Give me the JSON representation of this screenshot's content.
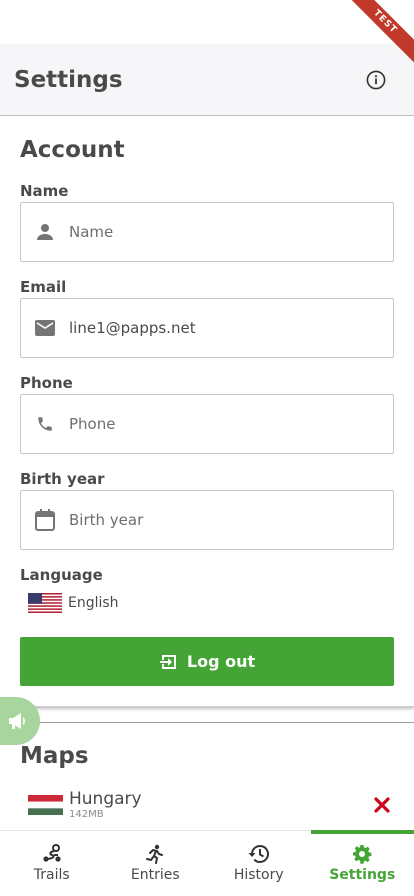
{
  "header": {
    "title": "Settings",
    "info_icon": "info-circle-icon"
  },
  "ribbon": {
    "label": "TEST"
  },
  "account": {
    "title": "Account",
    "name": {
      "label": "Name",
      "placeholder": "Name",
      "value": "",
      "icon": "person-icon"
    },
    "email": {
      "label": "Email",
      "placeholder": "Email",
      "value": "line1@papps.net",
      "icon": "mail-icon"
    },
    "phone": {
      "label": "Phone",
      "placeholder": "Phone",
      "value": "",
      "icon": "phone-icon"
    },
    "birth_year": {
      "label": "Birth year",
      "placeholder": "Birth year",
      "value": "",
      "icon": "calendar-icon"
    },
    "language": {
      "label": "Language",
      "value": "English",
      "flag": "us-flag-icon"
    },
    "logout_label": "Log out"
  },
  "maps": {
    "title": "Maps",
    "items": [
      {
        "name": "Hungary",
        "size": "142MB",
        "flag": "hungary-flag-icon"
      }
    ]
  },
  "tabs": [
    {
      "label": "Trails",
      "icon": "trail-icon",
      "active": false
    },
    {
      "label": "Entries",
      "icon": "runner-icon",
      "active": false
    },
    {
      "label": "History",
      "icon": "history-icon",
      "active": false
    },
    {
      "label": "Settings",
      "icon": "gear-icon",
      "active": true
    }
  ],
  "colors": {
    "accent": "#45a436",
    "delete": "#d0021b",
    "text": "#4a4a4a",
    "header_bg": "#f6f6f8"
  }
}
